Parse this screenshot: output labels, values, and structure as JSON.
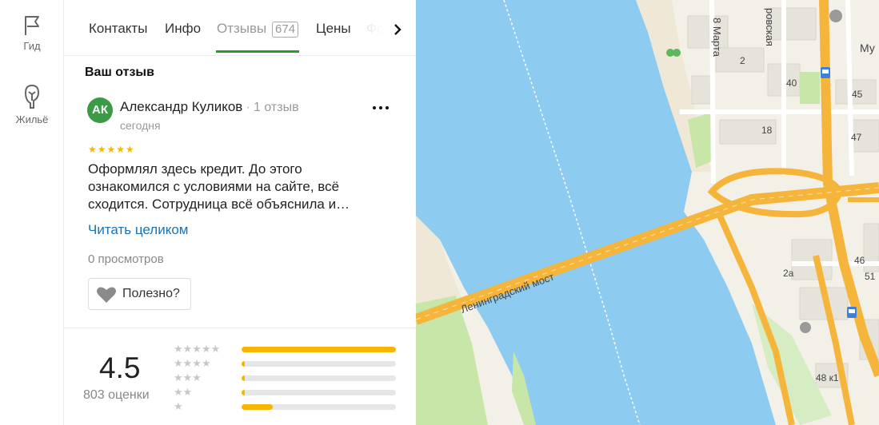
{
  "rail": {
    "items": [
      {
        "label": "Гид",
        "icon": "flag-icon"
      },
      {
        "label": "Жильё",
        "icon": "house-icon"
      }
    ]
  },
  "tabs": {
    "items": [
      {
        "label": "Контакты"
      },
      {
        "label": "Инфо"
      },
      {
        "label": "Отзывы",
        "count": "674",
        "active": true
      },
      {
        "label": "Цены"
      },
      {
        "label": "Фо"
      }
    ]
  },
  "your_review": {
    "title": "Ваш отзыв",
    "avatar_initials": "АК",
    "author": "Александр Куликов",
    "author_reviews": "1 отзыв",
    "date": "сегодня",
    "stars": "★★★★★",
    "rating": 5,
    "text": "Оформлял здесь кредит. До этого ознакомился с условиями на сайте, всё сходится. Сотрудница всё объяснила и…",
    "read_more": "Читать целиком",
    "views": "0 просмотров",
    "useful_label": "Полезно?"
  },
  "summary": {
    "rating": "4.5",
    "count_label": "803 оценки",
    "distribution": [
      {
        "stars": "★★★★★",
        "fraction": 1.0
      },
      {
        "stars": "★★★★",
        "fraction": 0.02
      },
      {
        "stars": "★★★",
        "fraction": 0.02
      },
      {
        "stars": "★★",
        "fraction": 0.02
      },
      {
        "stars": "★",
        "fraction": 0.2
      }
    ]
  },
  "map": {
    "labels": {
      "bridge": "Ленинградский мост",
      "street_march": "8 Марта",
      "street_partial": "ровская",
      "mu": "Му",
      "b2": "2",
      "b40": "40",
      "b45": "45",
      "b18": "18",
      "b47": "47",
      "b46": "46",
      "b51": "51",
      "b2a": "2а",
      "b48k1": "48 к1"
    },
    "colors": {
      "water": "#8ecbf0",
      "land": "#f3f0e8",
      "road": "#f5b53a",
      "green": "#c7e6a8",
      "sand": "#efe8d6"
    }
  },
  "colors": {
    "accent_green": "#2a9a2a",
    "star": "#f5b800",
    "link": "#1a73b8"
  }
}
